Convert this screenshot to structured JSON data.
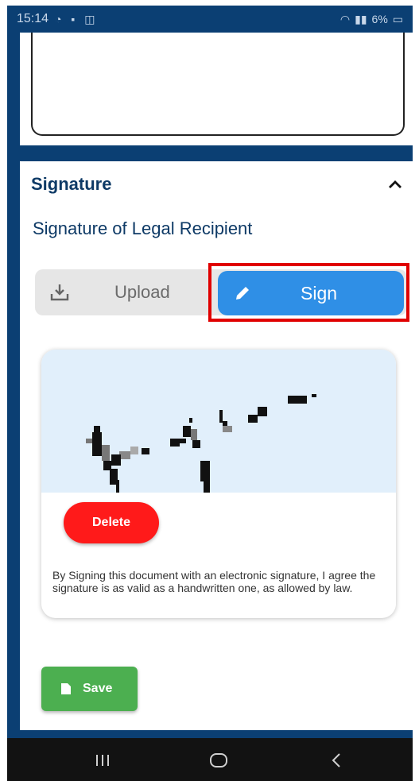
{
  "status_bar": {
    "time": "15:14",
    "battery": "6%"
  },
  "signature_section": {
    "title": "Signature",
    "subtitle": "Signature of Legal Recipient",
    "upload_label": "Upload",
    "sign_label": "Sign",
    "selected_mode": "Sign",
    "delete_label": "Delete",
    "disclaimer": "By Signing this document with an electronic signature, I agree the signature is as valid as a handwritten one, as allowed by law.",
    "save_label": "Save"
  },
  "colors": {
    "header_bg": "#0b3f73",
    "title_text": "#0e3a66",
    "sign_button": "#2f8fe6",
    "delete_button": "#ff1a1a",
    "save_button": "#4caf50",
    "signature_pad_bg": "#e1effb",
    "highlight": "#e00000"
  },
  "icons": {
    "upload": "download-tray-icon",
    "sign": "pencil-icon",
    "save": "document-icon",
    "collapse": "chevron-up-icon",
    "nav_recents": "recents-icon",
    "nav_home": "home-icon",
    "nav_back": "back-icon"
  }
}
